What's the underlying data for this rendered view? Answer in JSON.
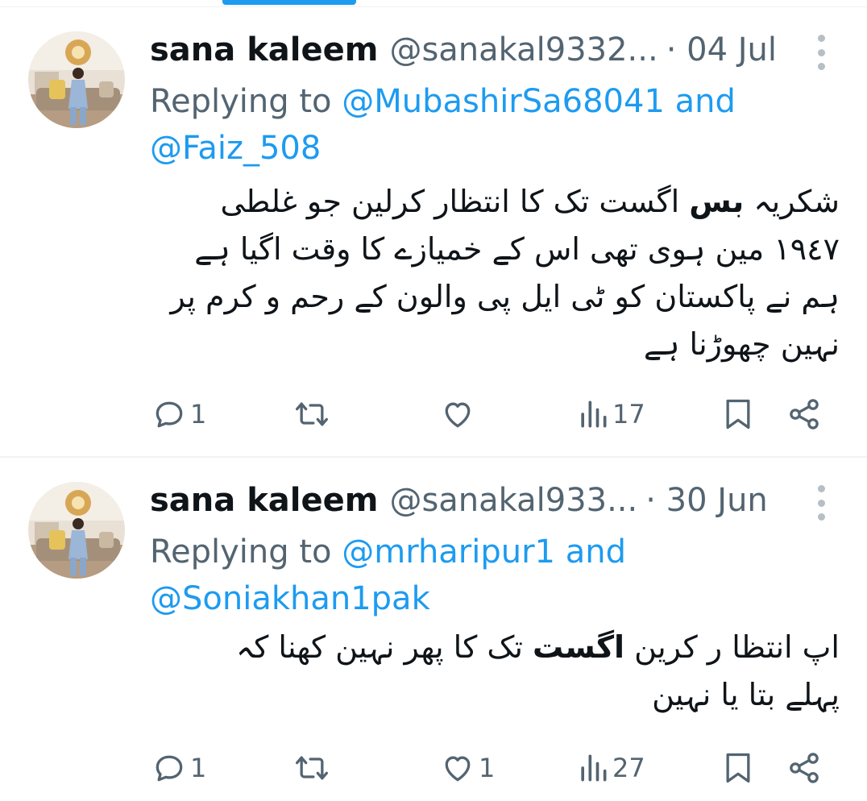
{
  "tweets": [
    {
      "name": "sana kaleem",
      "handle": "@sanakal9332...",
      "date": "· 04 Jul",
      "reply_prefix": "Replying to",
      "mention_1": "@MubashirSa68041",
      "reply_and": " and",
      "mention_2": "@Faiz_508",
      "content": {
        "line_1_a": "شکریہ ",
        "line_1_bold": "بس",
        "line_1_b": " اگست تک کا انتظار کرلین جو غلطی",
        "line_2": "١٩٤٧ مین ہوی تھی اس کے خمیازے کا وقت اگیا ہے",
        "line_3": "ہم نے پاکستان کو ٹی ایل پی والون کے رحم و کرم پر",
        "line_4": "نہین چھوڑنا ہے"
      },
      "stats": {
        "replies": "1",
        "reposts": "",
        "likes": "",
        "views": "17"
      }
    },
    {
      "name": "sana kaleem",
      "handle": "@sanakal933...",
      "date": "· 30 Jun",
      "reply_prefix": "Replying to",
      "mention_1": "@mrharipur1",
      "reply_and": " and",
      "mention_2": "@Soniakhan1pak",
      "content": {
        "line_1_a": "اپ انتظا ر کرین ",
        "line_1_bold": "اگست",
        "line_1_b": " تک کا     پھر نہین کھنا کہ",
        "line_2": "پہلے بتا یا نہین"
      },
      "stats": {
        "replies": "1",
        "reposts": "",
        "likes": "1",
        "views": "27"
      }
    }
  ],
  "colors": {
    "accent": "#1d9bf0",
    "secondary_text": "#536471",
    "primary_text": "#0f1419",
    "divider": "#eff3f4"
  },
  "icons": [
    "reply-icon",
    "repost-icon",
    "like-icon",
    "views-icon",
    "bookmark-icon",
    "share-icon",
    "more-options-icon"
  ]
}
